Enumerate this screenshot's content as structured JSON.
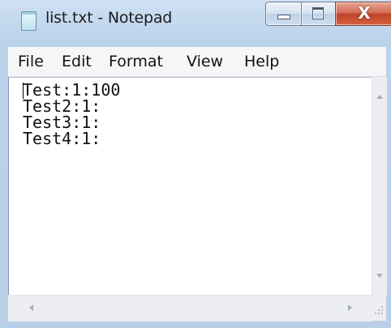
{
  "window": {
    "title": "list.txt - Notepad",
    "close_glyph": "X"
  },
  "icons": {
    "app": "notepad-icon",
    "minimize": "minimize-icon",
    "maximize": "maximize-icon",
    "close": "close-icon"
  },
  "menu": {
    "items": [
      "File",
      "Edit",
      "Format",
      "View",
      "Help"
    ]
  },
  "editor": {
    "lines": [
      "Test:1:100",
      "Test2:1:",
      "Test3:1:",
      "Test4:1:"
    ]
  },
  "colors": {
    "close_button": "#c0422a",
    "frame": "#bcd3ec"
  }
}
